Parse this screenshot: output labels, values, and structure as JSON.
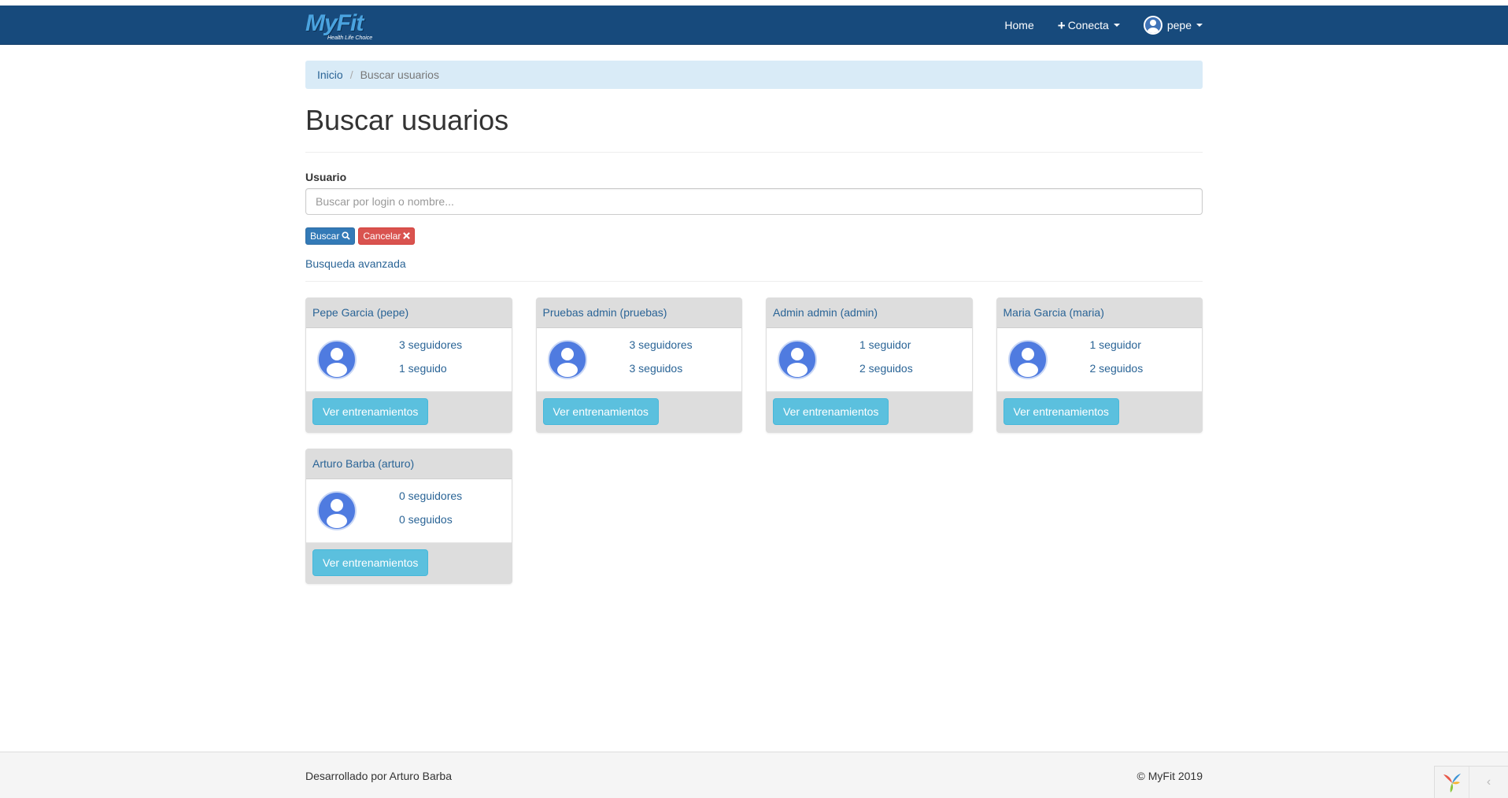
{
  "brand": {
    "name": "MyFit",
    "tagline": "Health Life Choice"
  },
  "nav": {
    "home": "Home",
    "conecta": "Conecta",
    "user": "pepe"
  },
  "breadcrumb": {
    "home": "Inicio",
    "current": "Buscar usuarios"
  },
  "page": {
    "title": "Buscar usuarios"
  },
  "search": {
    "label": "Usuario",
    "placeholder": "Buscar por login o nombre...",
    "value": "",
    "search_label": "Buscar",
    "cancel_label": "Cancelar",
    "advanced_label": "Busqueda avanzada"
  },
  "users": [
    {
      "name": "Pepe Garcia (pepe)",
      "followers": "3 seguidores",
      "following": "1 seguido",
      "action": "Ver entrenamientos"
    },
    {
      "name": "Pruebas admin (pruebas)",
      "followers": "3 seguidores",
      "following": "3 seguidos",
      "action": "Ver entrenamientos"
    },
    {
      "name": "Admin admin (admin)",
      "followers": "1 seguidor",
      "following": "2 seguidos",
      "action": "Ver entrenamientos"
    },
    {
      "name": "Maria Garcia (maria)",
      "followers": "1 seguidor",
      "following": "2 seguidos",
      "action": "Ver entrenamientos"
    },
    {
      "name": "Arturo Barba (arturo)",
      "followers": "0 seguidores",
      "following": "0 seguidos",
      "action": "Ver entrenamientos"
    }
  ],
  "footer": {
    "left": "Desarrollado por Arturo Barba",
    "right": "© MyFit 2019"
  },
  "colors": {
    "navbar": "#174a7c",
    "link": "#2a6496",
    "primary": "#337ab7",
    "danger": "#d9534f",
    "info": "#5bc0de",
    "breadcrumb_bg": "#d9ebf7"
  },
  "icons": {
    "search": "search-icon",
    "cancel": "close-icon",
    "plus": "plus-icon",
    "avatar": "user-avatar-icon"
  }
}
